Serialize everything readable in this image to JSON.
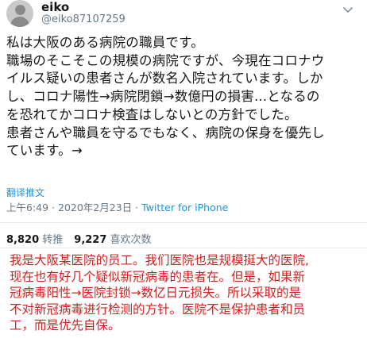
{
  "header": {
    "name": "eiko",
    "handle": "@eiko87107259"
  },
  "tweet": {
    "lines": [
      "私は大阪のある病院の職員です。",
      "職場のそこそこの規模の病院ですが、今現在コロナウ",
      "イルス疑いの患者さんが数名入院されています。しか",
      "し、コロナ陽性→病院閉鎖→数億円の損害...となるの",
      "を恐れてかコロナ検査はしないとの方針でした。",
      "患者さんや職員を守るでもなく、病院の保身を優先し",
      "ています。→"
    ],
    "translate_label": "翻译推文",
    "timestamp": "上午6:49 · 2020年2月23日 · ",
    "source": "Twitter for iPhone"
  },
  "stats": {
    "retweets_count": "8,820",
    "retweets_label": "转推",
    "likes_count": "9,227",
    "likes_label": "喜欢次数"
  },
  "translation": {
    "lines": [
      "我是大阪某医院的员工。我们医院也是规模挺大的医院,",
      "现在也有好几个疑似新冠病毒的患者在。但是，如果新",
      "冠病毒阳性→医院封锁→数亿日元损失。所以采取的是",
      "不对新冠病毒进行检测的方针。医院不是保护患者和员",
      "工，而是优先自保。"
    ]
  },
  "icons": {
    "avatar": "user-avatar",
    "menu": "chevron-down-icon"
  },
  "colors": {
    "link": "#1b95e0",
    "secondary_text": "#657786",
    "annotation_red": "#d21f1f"
  }
}
